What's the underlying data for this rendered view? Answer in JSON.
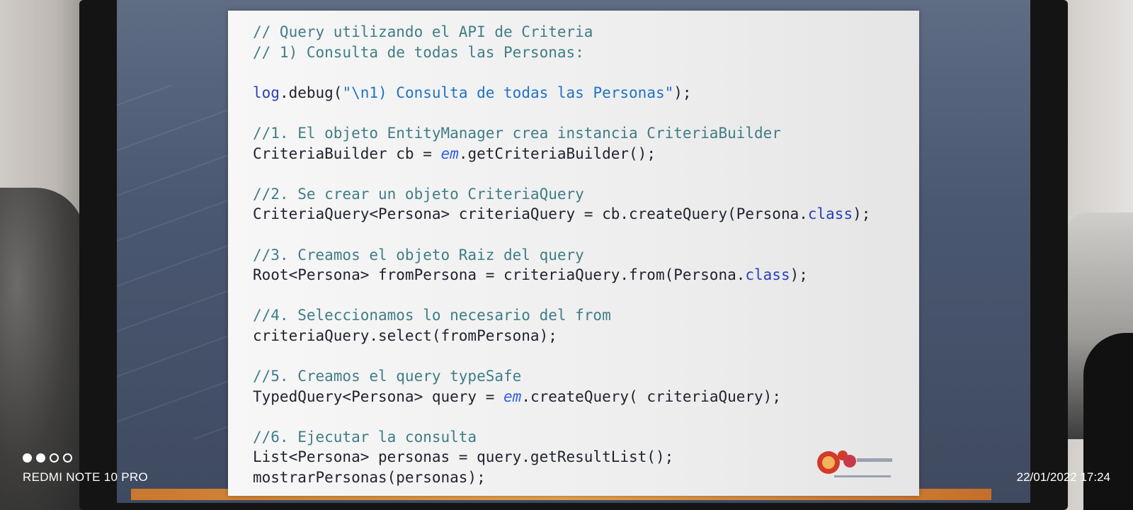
{
  "code_lines": [
    {
      "t": "cmt",
      "text": "// Query utilizando el API de Criteria"
    },
    {
      "t": "cmt",
      "text": "// 1) Consulta de todas las Personas:"
    },
    {
      "t": "blank",
      "text": ""
    },
    {
      "t": "log",
      "a": "log",
      "b": ".debug(",
      "c": "\"\\n1) Consulta de todas las Personas\"",
      "d": ");"
    },
    {
      "t": "blank",
      "text": ""
    },
    {
      "t": "cmt",
      "text": "//1. El objeto EntityManager crea instancia CriteriaBuilder"
    },
    {
      "t": "em",
      "a": "CriteriaBuilder cb = ",
      "b": "em",
      "c": ".getCriteriaBuilder();"
    },
    {
      "t": "blank",
      "text": ""
    },
    {
      "t": "cmt",
      "text": "//2. Se crear un objeto CriteriaQuery"
    },
    {
      "t": "cls",
      "a": "CriteriaQuery<Persona> criteriaQuery = cb.createQuery(Persona.",
      "b": "class",
      "c": ");"
    },
    {
      "t": "blank",
      "text": ""
    },
    {
      "t": "cmt",
      "text": "//3. Creamos el objeto Raiz del query"
    },
    {
      "t": "cls",
      "a": "Root<Persona> fromPersona = criteriaQuery.from(Persona.",
      "b": "class",
      "c": ");"
    },
    {
      "t": "blank",
      "text": ""
    },
    {
      "t": "cmt",
      "text": "//4. Seleccionamos lo necesario del from"
    },
    {
      "t": "plain",
      "text": "criteriaQuery.select(fromPersona);"
    },
    {
      "t": "blank",
      "text": ""
    },
    {
      "t": "cmt",
      "text": "//5. Creamos el query typeSafe"
    },
    {
      "t": "em",
      "a": "TypedQuery<Persona> query = ",
      "b": "em",
      "c": ".createQuery( criteriaQuery);"
    },
    {
      "t": "blank",
      "text": ""
    },
    {
      "t": "cmt",
      "text": "//6. Ejecutar la consulta"
    },
    {
      "t": "plain",
      "text": "List<Persona> personas = query.getResultList();"
    },
    {
      "t": "plain",
      "text": "mostrarPersonas(personas);"
    }
  ],
  "camera": {
    "model": "REDMI NOTE 10 PRO",
    "datetime": "22/01/2022 17:24"
  },
  "colors": {
    "comment": "#3f7d87",
    "keyword": "#2a3fb8",
    "string": "#1f72c8",
    "field": "#2f5be8"
  }
}
